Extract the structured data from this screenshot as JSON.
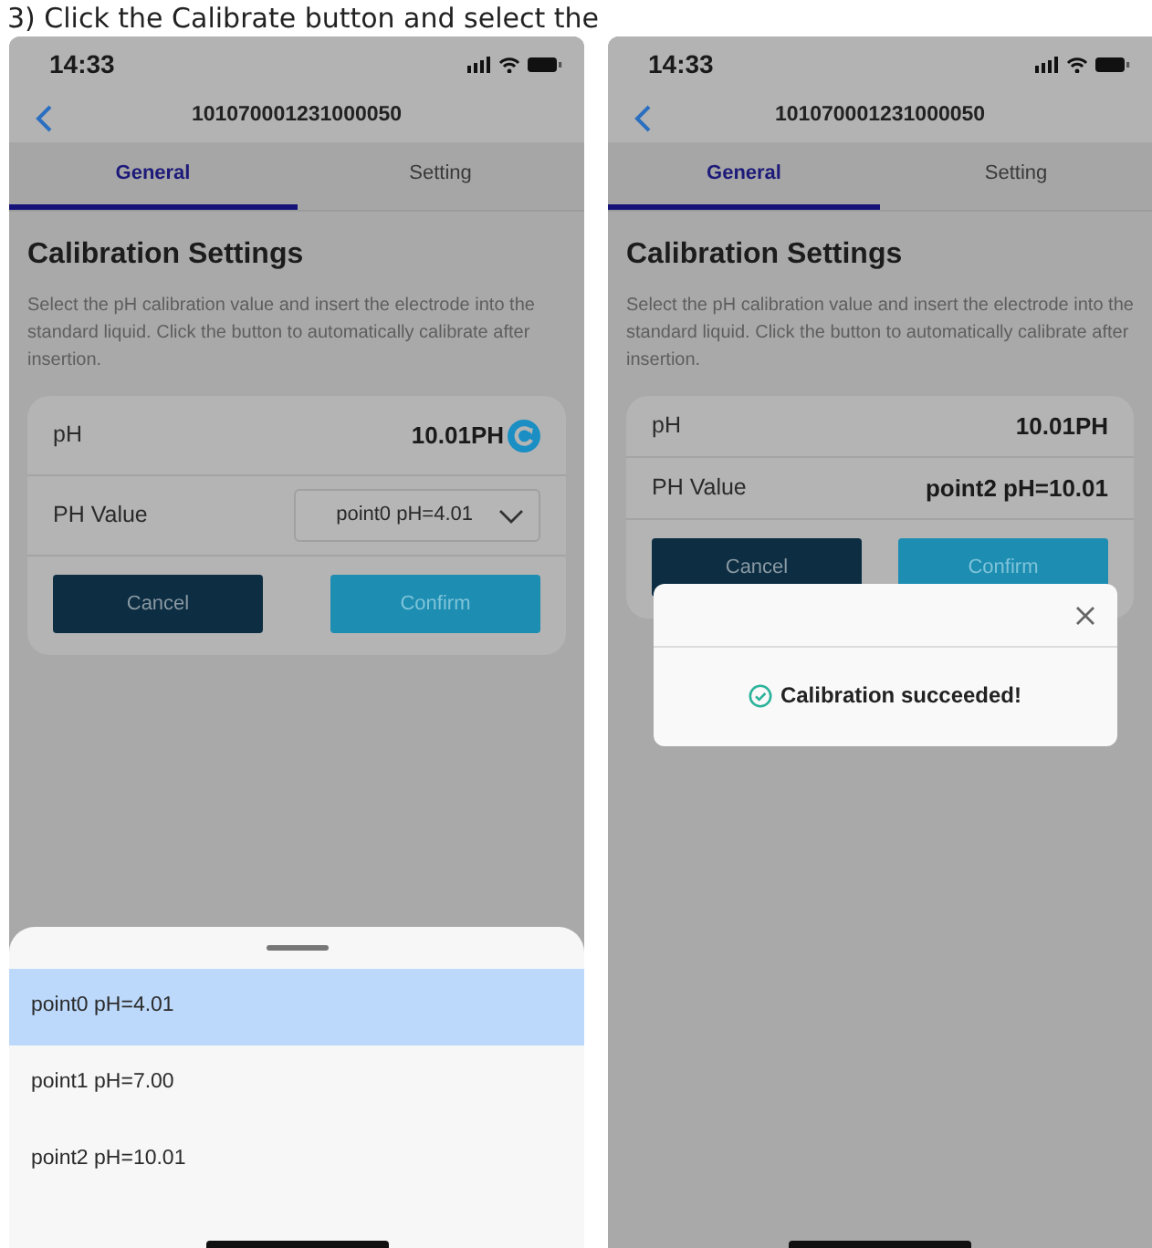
{
  "caption": "3)   Click the Calibrate button and select the",
  "screens": [
    {
      "time": "14:33",
      "title": "101070001231000050",
      "tabs": [
        {
          "label": "General",
          "selected": true
        },
        {
          "label": "Setting",
          "selected": false
        }
      ],
      "section_title": "Calibration Settings",
      "description": "Select the pH calibration value and insert the electrode into the standard liquid. Click the button to automatically calibrate after insertion.",
      "rows": [
        {
          "kind": "reading",
          "label": "pH",
          "value": "10.01PH",
          "refresh": true
        },
        {
          "kind": "dropdown",
          "label": "PH Value",
          "value": "point0 pH=4.01"
        }
      ],
      "buttons": [
        "Cancel",
        "Confirm"
      ],
      "sheet": {
        "options": [
          {
            "label": "point0 pH=4.01",
            "selected": true
          },
          {
            "label": "point1 pH=7.00",
            "selected": false
          },
          {
            "label": "point2 pH=10.01",
            "selected": false
          }
        ]
      }
    },
    {
      "time": "14:33",
      "title": "101070001231000050",
      "tabs": [
        {
          "label": "General",
          "selected": true
        },
        {
          "label": "Setting",
          "selected": false
        }
      ],
      "section_title": "Calibration Settings",
      "description": "Select the pH calibration value and insert the electrode into the standard liquid. Click the button to automatically calibrate after insertion.",
      "rows": [
        {
          "kind": "reading",
          "label": "pH",
          "value": "10.01PH",
          "refresh": false
        },
        {
          "kind": "text",
          "label": "PH Value",
          "value": "point2 pH=10.01"
        }
      ],
      "buttons": [
        "Cancel",
        "Confirm"
      ],
      "dialog": {
        "message": "Calibration succeeded!"
      }
    }
  ]
}
